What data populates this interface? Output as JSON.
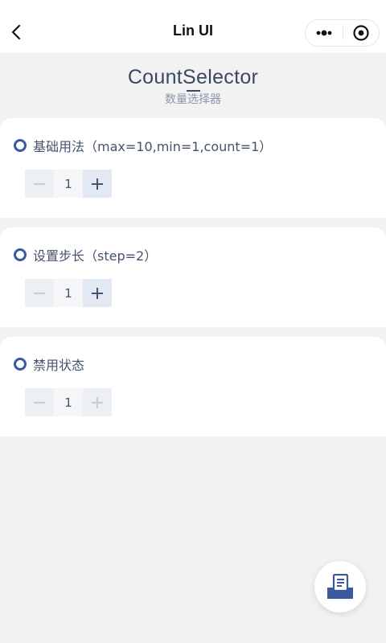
{
  "nav": {
    "title": "Lin UI",
    "back_icon": "chevron-left-icon",
    "more_icon": "more-dots-icon",
    "target_icon": "target-icon"
  },
  "header": {
    "title": "CountSelector",
    "subtitle": "数量选择器"
  },
  "sections": [
    {
      "title": "基础用法（max=10,min=1,count=1）",
      "value": "1",
      "minus_disabled": true,
      "plus_disabled": false
    },
    {
      "title": "设置步长（step=2）",
      "value": "1",
      "minus_disabled": true,
      "plus_disabled": false
    },
    {
      "title": "禁用状态",
      "value": "1",
      "minus_disabled": true,
      "plus_disabled": true
    }
  ],
  "colors": {
    "accent": "#3a5a9c",
    "plus_active": "#45526b",
    "disabled": "#c8ccd3",
    "background": "#f2f2f2"
  },
  "fab": {
    "icon": "document-tray-icon"
  }
}
